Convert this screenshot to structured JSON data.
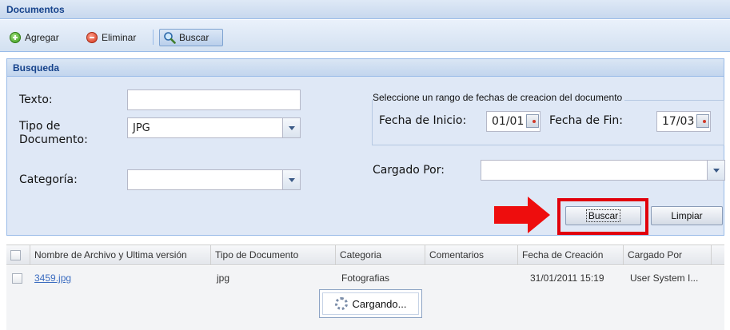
{
  "panel": {
    "title": "Documentos"
  },
  "toolbar": {
    "add_label": "Agregar",
    "delete_label": "Eliminar",
    "search_label": "Buscar"
  },
  "search": {
    "title": "Busqueda",
    "text_label": "Texto:",
    "text_value": "",
    "doc_type_label": "Tipo de Documento:",
    "doc_type_value": "JPG",
    "category_label": "Categoría:",
    "category_value": "",
    "date_range_legend": "Seleccione un rango de fechas de creacion del documento",
    "start_label": "Fecha de Inicio:",
    "start_value": "01/01",
    "end_label": "Fecha de Fin:",
    "end_value": "17/03",
    "uploaded_by_label": "Cargado Por:",
    "uploaded_by_value": "",
    "search_button": "Buscar",
    "clear_button": "Limpiar"
  },
  "grid": {
    "columns": [
      "Nombre de Archivo y Ultima versión",
      "Tipo de Documento",
      "Categoria",
      "Comentarios",
      "Fecha de Creación",
      "Cargado Por"
    ],
    "rows": [
      {
        "name": "3459.jpg",
        "type": "jpg",
        "category": "Fotografias",
        "comments": "",
        "created": "31/01/2011 15:19",
        "uploaded_by": "User System I..."
      }
    ]
  },
  "loading": {
    "text": "Cargando..."
  },
  "colors": {
    "header_blue": "#15428b",
    "highlight_red": "#e1000c",
    "panel_bg": "#dfe8f6"
  },
  "icons": {
    "add": "add-circle-icon",
    "delete": "remove-circle-icon",
    "search": "magnifier-icon",
    "calendar": "calendar-icon",
    "dropdown": "chevron-down-icon",
    "spinner": "loading-spinner-icon",
    "arrow": "red-arrow-icon"
  }
}
